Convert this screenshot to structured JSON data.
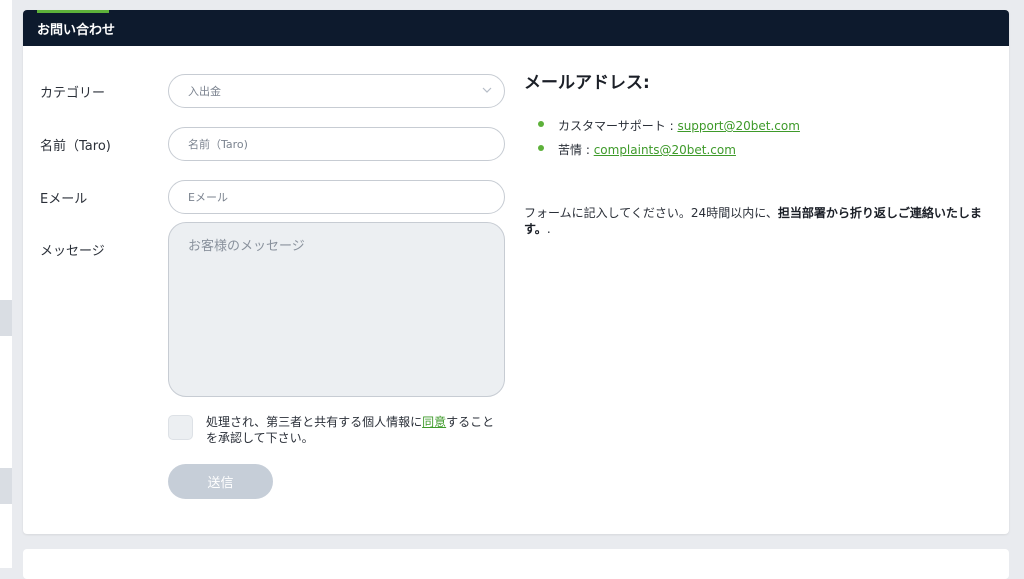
{
  "header": {
    "title": "お問い合わせ"
  },
  "form": {
    "category_label": "カテゴリー",
    "category_value": "入出金",
    "name_label": "名前（Taro)",
    "name_placeholder": "名前（Taro)",
    "email_label": "Eメール",
    "email_placeholder": "Eメール",
    "message_label": "メッセージ",
    "message_placeholder": "お客様のメッセージ",
    "consent_before": "処理され、第三者と共有する個人情報に",
    "consent_link": "同意",
    "consent_after": "することを承認して下さい。",
    "submit_label": "送信"
  },
  "info": {
    "heading": "メールアドレス:",
    "emails": [
      {
        "label": "カスタマーサポート : ",
        "address": "support@20bet.com"
      },
      {
        "label": "苦情 : ",
        "address": "complaints@20bet.com"
      }
    ],
    "note_plain": "フォームに記入してください。24時間以内に、",
    "note_bold": "担当部署から折り返しご連絡いたします。",
    "note_tail": "."
  },
  "colors": {
    "header_bg": "#0d1a2d",
    "accent": "#5db13a",
    "link": "#3e9a2a",
    "button_disabled": "#c6ced8"
  },
  "icons": {
    "select_chevron": "chevron-down-icon",
    "bullet": "bullet-dot-icon"
  }
}
